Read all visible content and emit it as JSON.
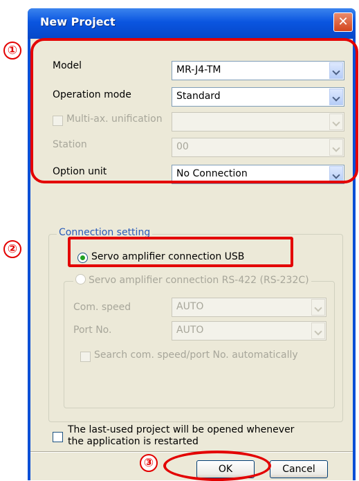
{
  "window": {
    "title": "New Project",
    "close_icon": "close-icon"
  },
  "markers": {
    "m1": "①",
    "m2": "②",
    "m3": "③"
  },
  "annotation_color": "#e30000",
  "form": {
    "model_label": "Model",
    "model_value": "MR-J4-TM",
    "opmode_label": "Operation mode",
    "opmode_value": "Standard",
    "multiax_label": "Multi-ax. unification",
    "multiax_value": "",
    "station_label": "Station",
    "station_value": "00",
    "option_label": "Option unit",
    "option_value": "No Connection"
  },
  "connection": {
    "legend": "Connection setting",
    "usb_label": "Servo amplifier connection USB",
    "rs422_label": "Servo amplifier connection RS-422 (RS-232C)",
    "comspeed_label": "Com. speed",
    "comspeed_value": "AUTO",
    "port_label": "Port No.",
    "port_value": "AUTO",
    "search_label": "Search com. speed/port No. automatically"
  },
  "footer": {
    "lastused_line1": "The last-used project will be opened whenever",
    "lastused_line2": "the application is restarted",
    "ok_label": "OK",
    "cancel_label": "Cancel"
  }
}
